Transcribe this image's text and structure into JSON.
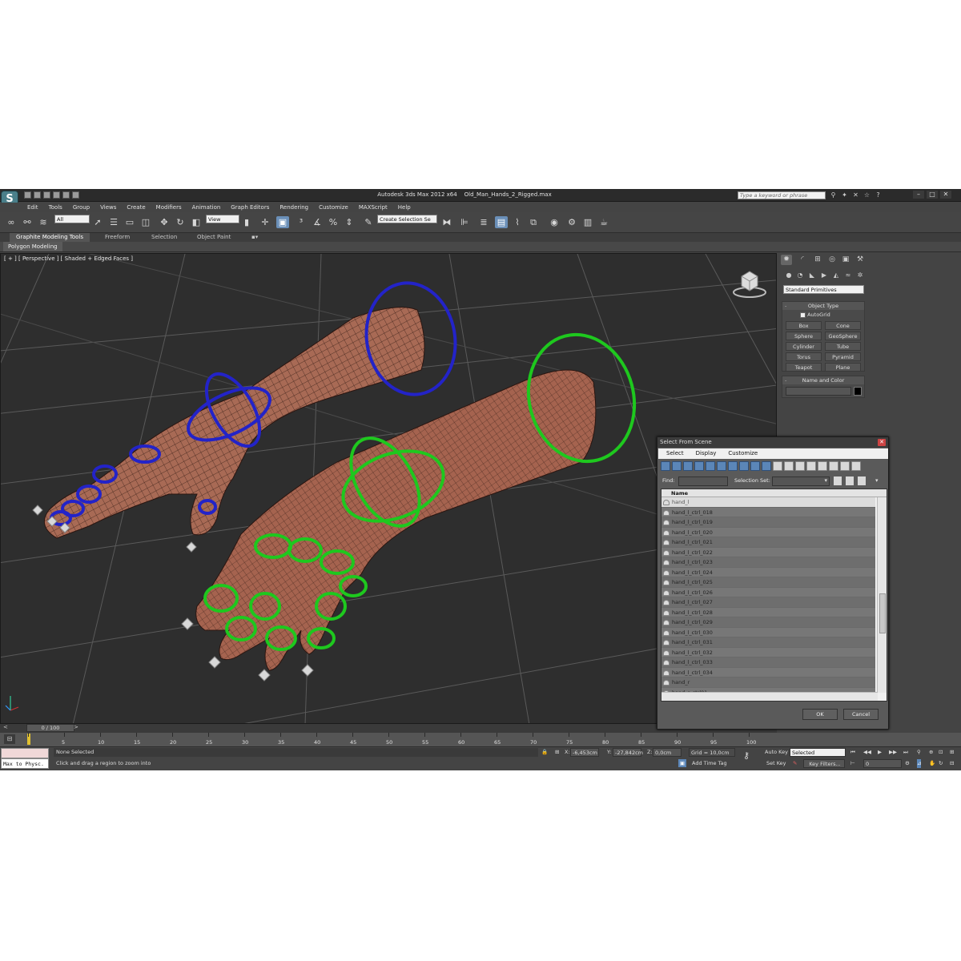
{
  "app": {
    "title": "Autodesk 3ds Max  2012 x64",
    "file": "Old_Man_Hands_2_Rigged.max",
    "search_placeholder": "Type a keyword or phrase",
    "logo_glyph": "S"
  },
  "menu": [
    "Edit",
    "Tools",
    "Group",
    "Views",
    "Create",
    "Modifiers",
    "Animation",
    "Graph Editors",
    "Rendering",
    "Customize",
    "MAXScript",
    "Help"
  ],
  "toolbar": {
    "selection_filter": "All",
    "ref_coord": "View",
    "named_selection": "Create Selection Se"
  },
  "ribbon": {
    "tabs": [
      "Graphite Modeling Tools",
      "Freeform",
      "Selection",
      "Object Paint"
    ],
    "subtab": "Polygon Modeling"
  },
  "viewport": {
    "label": "[ + ] [ Perspective ] [ Shaded + Edged Faces ]"
  },
  "command_panel": {
    "dropdown": "Standard Primitives",
    "object_type_title": "Object Type",
    "autogrid": "AutoGrid",
    "buttons": [
      "Box",
      "Cone",
      "Sphere",
      "GeoSphere",
      "Cylinder",
      "Tube",
      "Torus",
      "Pyramid",
      "Teapot",
      "Plane"
    ],
    "name_color_title": "Name and Color"
  },
  "dialog": {
    "title": "Select From Scene",
    "menu": [
      "Select",
      "Display",
      "Customize"
    ],
    "find_label": "Find:",
    "selset_label": "Selection Set:",
    "column": "Name",
    "rows": [
      "hand_l",
      "hand_l_ctrl_018",
      "hand_l_ctrl_019",
      "hand_l_ctrl_020",
      "hand_l_ctrl_021",
      "hand_l_ctrl_022",
      "hand_l_ctrl_023",
      "hand_l_ctrl_024",
      "hand_l_ctrl_025",
      "hand_l_ctrl_026",
      "hand_l_ctrl_027",
      "hand_l_ctrl_028",
      "hand_l_ctrl_029",
      "hand_l_ctrl_030",
      "hand_l_ctrl_031",
      "hand_l_ctrl_032",
      "hand_l_ctrl_033",
      "hand_l_ctrl_034",
      "hand_r",
      "hand_r_ctrl01"
    ],
    "ok": "OK",
    "cancel": "Cancel"
  },
  "timeline": {
    "slider": "0 / 100",
    "ticks": [
      "0",
      "5",
      "10",
      "15",
      "20",
      "25",
      "30",
      "35",
      "40",
      "45",
      "50",
      "55",
      "60",
      "65",
      "70",
      "75",
      "80",
      "85",
      "90",
      "95",
      "100"
    ]
  },
  "status": {
    "maxscript": "Max to Physc.",
    "selection": "None Selected",
    "prompt": "Click and drag a region to zoom into",
    "x_label": "X:",
    "x": "-6,453cm",
    "y_label": "Y:",
    "y": "-27,842cm",
    "z_label": "Z:",
    "z": "0,0cm",
    "grid": "Grid = 10,0cm",
    "add_time_tag": "Add Time Tag",
    "auto_key": "Auto Key",
    "set_key": "Set Key",
    "key_mode": "Selected",
    "key_filters": "Key Filters...",
    "frame": "0"
  },
  "colors": {
    "left_rig": "#2323c8",
    "right_rig": "#1ec81e",
    "skin": "#a86a55",
    "viewport_bg": "#2e2e2e"
  }
}
